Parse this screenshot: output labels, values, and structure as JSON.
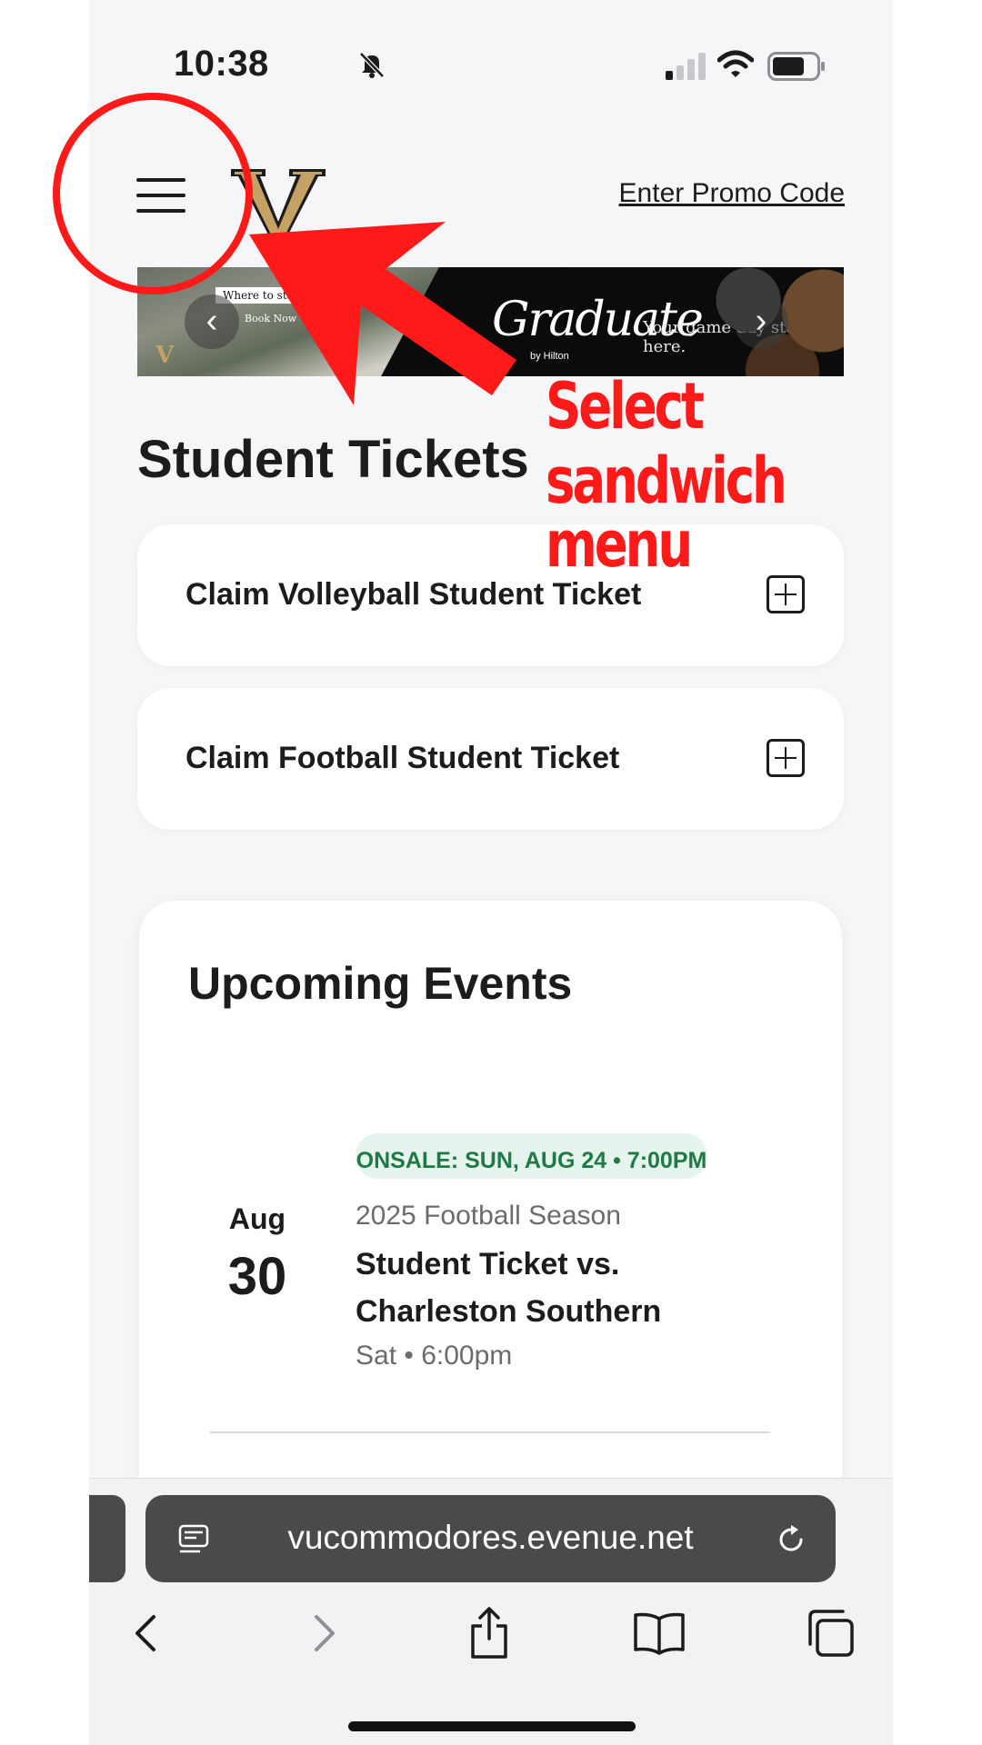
{
  "status_bar": {
    "time": "10:38",
    "icons": [
      "bell-slash-icon",
      "signal-icon",
      "wifi-icon",
      "battery-icon"
    ]
  },
  "header": {
    "menu_icon": "hamburger-menu-icon",
    "logo": "vanderbilt-v-logo",
    "promo_link": "Enter Promo Code"
  },
  "banner": {
    "where": "Where to stay",
    "book": "Book Now",
    "brand": "Graduate",
    "brand_sub": "by Hilton",
    "tagline": "Your game day starts here.",
    "prev": "‹",
    "next": "›"
  },
  "student_tickets": {
    "title": "Student Tickets",
    "items": [
      {
        "label": "Claim Volleyball Student Ticket"
      },
      {
        "label": "Claim Football Student Ticket"
      }
    ]
  },
  "events": {
    "title": "Upcoming Events",
    "items": [
      {
        "onsale": "ONSALE: SUN, AUG 24 • 7:00PM",
        "month": "Aug",
        "day": "30",
        "season": "2025 Football Season",
        "name": "Student Ticket vs. Charleston Southern",
        "time": "Sat • 6:00pm"
      }
    ]
  },
  "browser": {
    "url": "vucommodores.evenue.net",
    "toolbar": [
      "back-icon",
      "forward-icon",
      "share-icon",
      "bookmarks-icon",
      "tabs-icon"
    ]
  },
  "annotation": {
    "line1": "Select",
    "line2": "sandwich menu",
    "color": "#ff1a1a"
  },
  "colors": {
    "gold": "#c4a264",
    "onsale_green": "#1f7a45",
    "onsale_bg": "#e5f4ec"
  }
}
